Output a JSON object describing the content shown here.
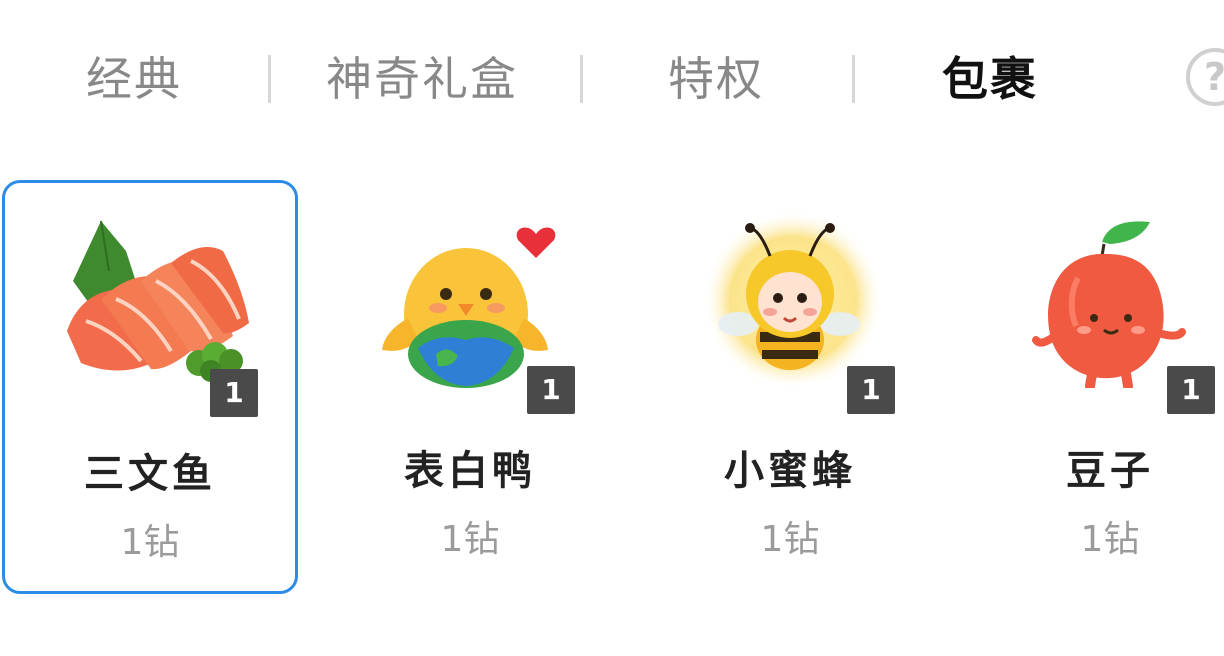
{
  "tabs": [
    {
      "label": "经典",
      "active": false
    },
    {
      "label": "神奇礼盒",
      "active": false
    },
    {
      "label": "特权",
      "active": false
    },
    {
      "label": "包裹",
      "active": true
    }
  ],
  "help_glyph": "?",
  "colors": {
    "selected_border": "#2b8ce8",
    "active_tab": "#111111",
    "inactive_tab": "#888888",
    "badge_bg": "#4a4a4a"
  },
  "items": [
    {
      "name": "三文鱼",
      "price": "1钻",
      "count": "1",
      "icon": "salmon-sashimi-icon",
      "selected": true
    },
    {
      "name": "表白鸭",
      "price": "1钻",
      "count": "1",
      "icon": "love-duck-icon",
      "selected": false
    },
    {
      "name": "小蜜蜂",
      "price": "1钻",
      "count": "1",
      "icon": "little-bee-icon",
      "selected": false
    },
    {
      "name": "豆子",
      "price": "1钻",
      "count": "1",
      "icon": "bean-icon",
      "selected": false
    }
  ]
}
